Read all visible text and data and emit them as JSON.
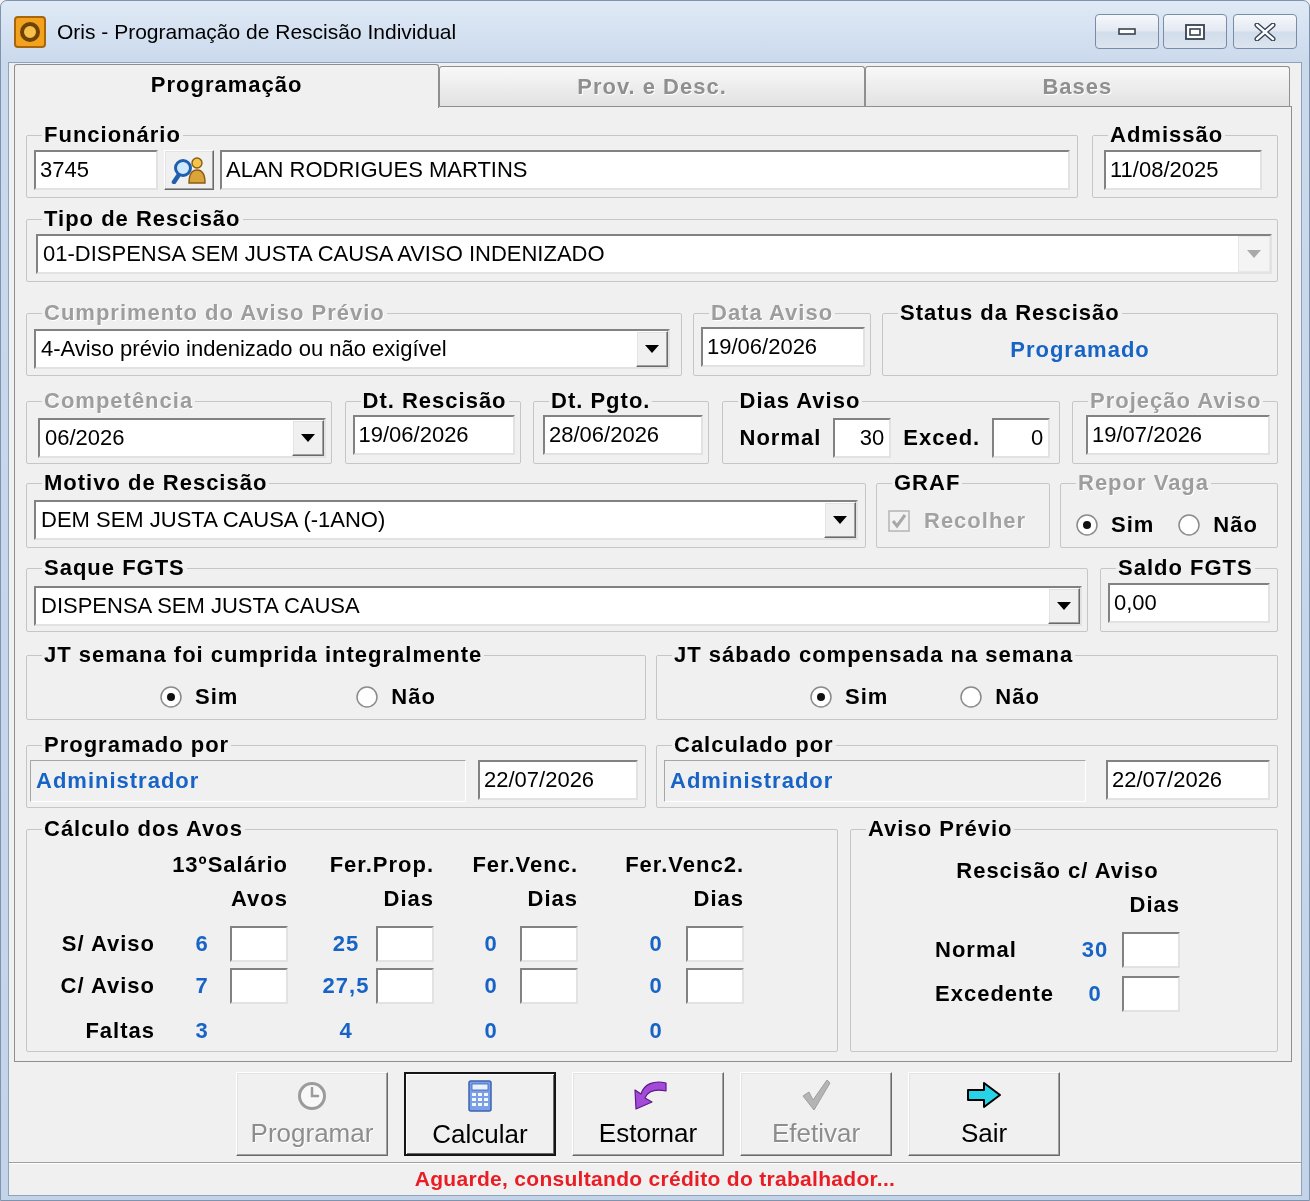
{
  "window": {
    "title": "Oris - Programação de Rescisão Individual"
  },
  "tabs": [
    {
      "label": "Programação",
      "selected": true,
      "disabled": false
    },
    {
      "label": "Prov. e Desc.",
      "selected": false,
      "disabled": true
    },
    {
      "label": "Bases",
      "selected": false,
      "disabled": true
    }
  ],
  "groups": [
    {
      "title": "Funcionário",
      "disabled": false,
      "controls": [
        {
          "kind": "field",
          "value": "3745"
        },
        {
          "kind": "lookup"
        },
        {
          "kind": "field",
          "value": "ALAN RODRIGUES MARTINS"
        }
      ]
    },
    {
      "title": "Admissão",
      "disabled": false,
      "controls": [
        {
          "kind": "field",
          "value": "11/08/2025"
        }
      ]
    },
    {
      "title": "Tipo de Rescisão",
      "disabled": false,
      "controls": [
        {
          "kind": "combo",
          "value": "01-DISPENSA SEM JUSTA CAUSA AVISO INDENIZADO",
          "disabled": true
        }
      ]
    },
    {
      "title": "Cumprimento do Aviso Prévio",
      "disabled": true,
      "controls": [
        {
          "kind": "combo",
          "value": "4-Aviso prévio indenizado ou não exigível",
          "disabled": false
        }
      ]
    },
    {
      "title": "Data Aviso",
      "disabled": true,
      "controls": [
        {
          "kind": "field",
          "value": "19/06/2026"
        }
      ]
    },
    {
      "title": "Status da Rescisão",
      "disabled": false,
      "controls": [
        {
          "kind": "status",
          "value": "Programado"
        }
      ]
    },
    {
      "title": "Competência",
      "disabled": true,
      "controls": [
        {
          "kind": "combo",
          "value": "06/2026",
          "disabled": false
        }
      ]
    },
    {
      "title": "Dt. Rescisão",
      "disabled": false,
      "controls": [
        {
          "kind": "field",
          "value": "19/06/2026"
        }
      ]
    },
    {
      "title": "Dt. Pgto.",
      "disabled": false,
      "controls": [
        {
          "kind": "field",
          "value": "28/06/2026"
        }
      ]
    },
    {
      "title": "Dias Aviso",
      "disabled": false,
      "controls": [
        {
          "kind": "caption",
          "value": "Normal"
        },
        {
          "kind": "number",
          "value": "30"
        },
        {
          "kind": "caption",
          "value": "Exced."
        },
        {
          "kind": "number",
          "value": "0"
        }
      ]
    },
    {
      "title": "Projeção Aviso",
      "disabled": true,
      "controls": [
        {
          "kind": "field",
          "value": "19/07/2026"
        }
      ]
    },
    {
      "title": "Motivo de Rescisão",
      "disabled": false,
      "controls": [
        {
          "kind": "combo",
          "value": "DEM SEM JUSTA CAUSA (-1ANO)",
          "disabled": false
        }
      ]
    },
    {
      "title": "GRAF",
      "disabled": false,
      "controls": [
        {
          "kind": "checkbox",
          "label": "Recolher",
          "checked": true,
          "disabled": true
        }
      ]
    },
    {
      "title": "Repor Vaga",
      "disabled": true,
      "controls": [
        {
          "kind": "radio",
          "label": "Sim",
          "selected": true
        },
        {
          "kind": "radio",
          "label": "Não",
          "selected": false
        }
      ]
    },
    {
      "title": "Saque FGTS",
      "disabled": false,
      "controls": [
        {
          "kind": "combo",
          "value": "DISPENSA SEM JUSTA CAUSA",
          "disabled": false
        }
      ]
    },
    {
      "title": "Saldo FGTS",
      "disabled": false,
      "controls": [
        {
          "kind": "field",
          "value": "0,00"
        }
      ]
    },
    {
      "title": "JT semana foi cumprida integralmente",
      "disabled": false,
      "controls": [
        {
          "kind": "radio",
          "label": "Sim",
          "selected": true
        },
        {
          "kind": "radio",
          "label": "Não",
          "selected": false
        }
      ]
    },
    {
      "title": "JT sábado compensada na semana",
      "disabled": false,
      "controls": [
        {
          "kind": "radio",
          "label": "Sim",
          "selected": true
        },
        {
          "kind": "radio",
          "label": "Não",
          "selected": false
        }
      ]
    },
    {
      "title": "Programado por",
      "disabled": false,
      "controls": [
        {
          "kind": "user",
          "value": "Administrador"
        },
        {
          "kind": "field",
          "value": "22/07/2026"
        }
      ]
    },
    {
      "title": "Calculado por",
      "disabled": false,
      "controls": [
        {
          "kind": "user",
          "value": "Administrador"
        },
        {
          "kind": "field",
          "value": "22/07/2026"
        }
      ]
    }
  ],
  "calculo_dos_avos": {
    "title": "Cálculo dos Avos",
    "disabled": false,
    "columns": [
      {
        "heading": "13ºSalário",
        "unit": "Avos"
      },
      {
        "heading": "Fer.Prop.",
        "unit": "Dias"
      },
      {
        "heading": "Fer.Venc.",
        "unit": "Dias"
      },
      {
        "heading": "Fer.Venc2.",
        "unit": "Dias"
      }
    ],
    "rows": [
      {
        "label": "S/ Aviso",
        "kind": "entry",
        "values": [
          "6",
          "25",
          "0",
          "0"
        ]
      },
      {
        "label": "C/ Aviso",
        "kind": "entry",
        "values": [
          "7",
          "27,5",
          "0",
          "0"
        ]
      },
      {
        "label": "Faltas",
        "kind": "total",
        "values": [
          "3",
          "4",
          "0",
          "0"
        ]
      }
    ]
  },
  "aviso_previo": {
    "title": "Aviso Prévio",
    "disabled": false,
    "heading": "Rescisão c/ Aviso",
    "unit": "Dias",
    "rows": [
      {
        "label": "Normal",
        "value": "30"
      },
      {
        "label": "Excedente",
        "value": "0"
      }
    ]
  },
  "buttons": [
    {
      "label": "Programar",
      "disabled": true,
      "focused": false
    },
    {
      "label": "Calcular",
      "disabled": false,
      "focused": true
    },
    {
      "label": "Estornar",
      "disabled": false,
      "focused": false
    },
    {
      "label": "Efetivar",
      "disabled": true,
      "focused": false
    },
    {
      "label": "Sair",
      "disabled": false,
      "focused": false
    }
  ],
  "status_bar": {
    "message": "Aguarde, consultando crédito do trabalhador..."
  }
}
